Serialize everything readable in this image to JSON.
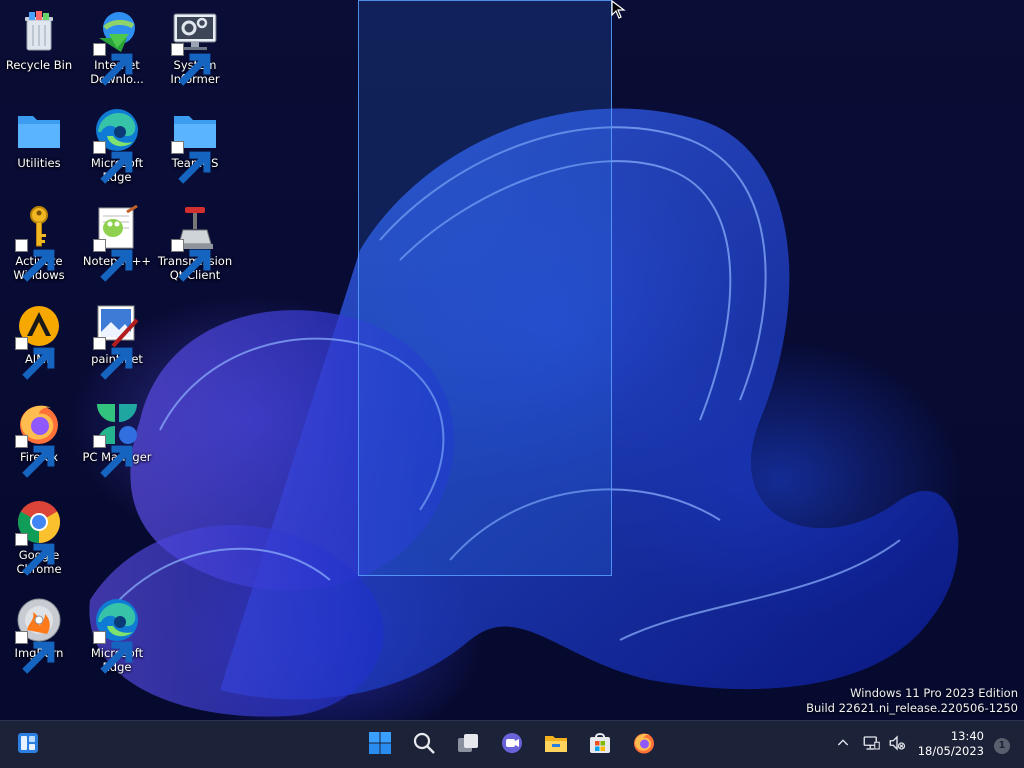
{
  "desktop": {
    "icons": [
      {
        "label": "Recycle Bin",
        "icon": "recycle-bin-icon",
        "shortcut": false
      },
      {
        "label": "Internet Downlo...",
        "icon": "internet-download-manager-icon",
        "shortcut": true
      },
      {
        "label": "System Informer",
        "icon": "system-informer-icon",
        "shortcut": true
      },
      {
        "label": "Utilities",
        "icon": "folder-icon",
        "shortcut": false
      },
      {
        "label": "Microsoft Edge",
        "icon": "edge-icon",
        "shortcut": true
      },
      {
        "label": "TeamOS",
        "icon": "folder-icon",
        "shortcut": true
      },
      {
        "label": "Activate Windows",
        "icon": "key-icon",
        "shortcut": true
      },
      {
        "label": "Notepad++",
        "icon": "notepadpp-icon",
        "shortcut": true
      },
      {
        "label": "Transmission Qt Client",
        "icon": "transmission-icon",
        "shortcut": true
      },
      {
        "label": "AIMP",
        "icon": "aimp-icon",
        "shortcut": true
      },
      {
        "label": "paint.net",
        "icon": "paintnet-icon",
        "shortcut": true
      },
      {
        "label": "Firefox",
        "icon": "firefox-icon",
        "shortcut": true
      },
      {
        "label": "PC Manager",
        "icon": "pc-manager-icon",
        "shortcut": true
      },
      {
        "label": "Google Chrome",
        "icon": "chrome-icon",
        "shortcut": true
      },
      {
        "label": "ImgBurn",
        "icon": "imgburn-icon",
        "shortcut": true
      },
      {
        "label": "Microsoft Edge",
        "icon": "edge-icon",
        "shortcut": true
      }
    ]
  },
  "watermark": {
    "line1": "Windows 11 Pro 2023 Edition",
    "line2": "Build 22621.ni_release.220506-1250"
  },
  "taskbar": {
    "widgets_icon": "widgets-icon",
    "pinned": [
      "start-icon",
      "search-icon",
      "task-view-icon",
      "teams-chat-icon",
      "file-explorer-icon",
      "microsoft-store-icon",
      "firefox-icon"
    ],
    "tray": [
      "chevron-up-icon",
      "network-icon",
      "volume-muted-icon"
    ],
    "time": "13:40",
    "date": "18/05/2023",
    "notifications": "1"
  },
  "colors": {
    "accent": "#2b7fe0",
    "taskbar": "#1c2237"
  }
}
